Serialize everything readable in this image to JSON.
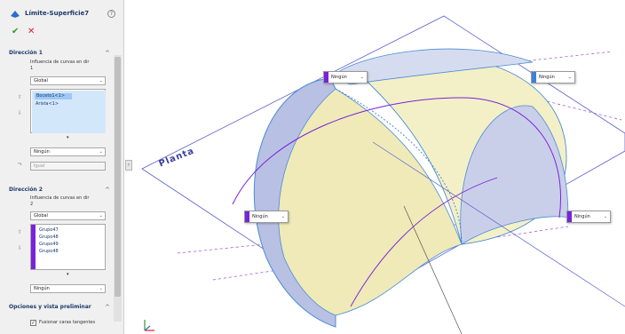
{
  "panel": {
    "title": "Límite-Superficie7",
    "help_glyph": "?",
    "ok_glyph": "✔",
    "cancel_glyph": "✕",
    "collapse_glyph": "^",
    "direction1": {
      "header": "Dirección 1",
      "influence_label_line1": "Influencia de curvas en dir",
      "influence_label_line2": "1",
      "influence_value": "Global",
      "items": [
        "Boceto1<1>",
        "Arista<1>"
      ],
      "tangency_value": "Ningún",
      "disabled_value": "Igual"
    },
    "direction2": {
      "header": "Dirección 2",
      "influence_label_line1": "Influencia de curvas en dir",
      "influence_label_line2": "2",
      "influence_value": "Global",
      "items": [
        "Grupo47",
        "Grupo48",
        "Grupo49",
        "Grupo48"
      ],
      "tangency_value": "Ningún"
    },
    "options_header": "Opciones y vista preliminar",
    "merge_checkbox_label": "Fusionar caras tangentes",
    "merge_checked": true,
    "dropdown_glyph": "⌄",
    "splitter_glyph": "›"
  },
  "viewport": {
    "plane_label": "Planta",
    "tags": [
      {
        "label": "Ningún",
        "color": "#7a22d8"
      },
      {
        "label": "Ningún",
        "color": "#3b82d9"
      },
      {
        "label": "Ningún",
        "color": "#7a22d8"
      },
      {
        "label": "Ningún",
        "color": "#7a22d8"
      }
    ]
  },
  "colors": {
    "accent_purple": "#7a22d8",
    "accent_blue": "#3b82d9",
    "surface_yellow": "#f3f0c7",
    "surface_blue": "#b8c0e3",
    "plane_outline": "#5b5fcf"
  }
}
